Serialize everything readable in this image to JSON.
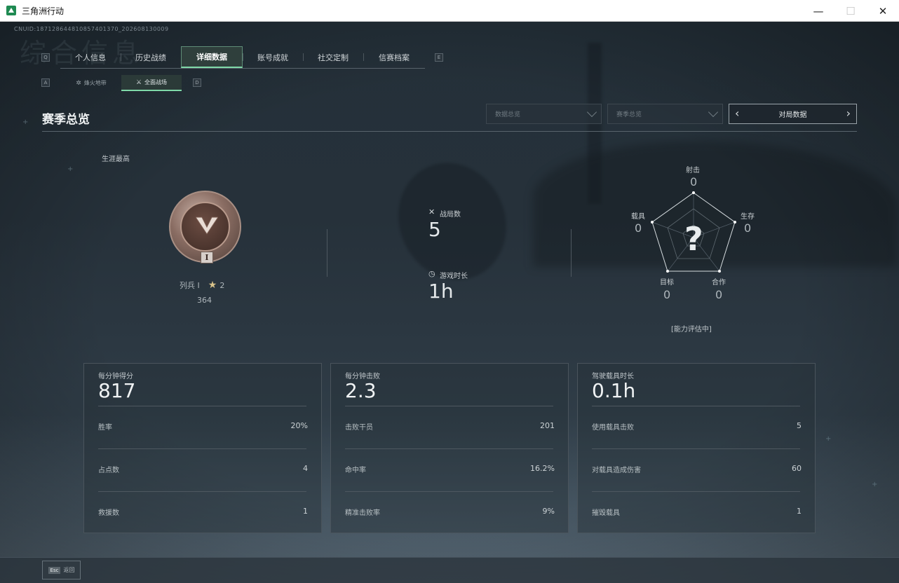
{
  "window": {
    "title": "三角洲行动",
    "minimize": "—",
    "maximize": "☐",
    "close": "✕"
  },
  "header": {
    "uid": "CNUID:187128644810857401370_202608130009",
    "ghost_title": "综合信息"
  },
  "hint_keys": {
    "left_main": "Q",
    "right_main": "E",
    "left_sub": "A",
    "right_sub": "D"
  },
  "main_tabs": [
    {
      "label": "个人信息"
    },
    {
      "label": "历史战绩"
    },
    {
      "label": "详细数据",
      "active": true
    },
    {
      "label": "账号成就"
    },
    {
      "label": "社交定制"
    },
    {
      "label": "信赛档案"
    }
  ],
  "sub_tabs": [
    {
      "label": "烽火地带",
      "icon": "flame-icon"
    },
    {
      "label": "全面战场",
      "icon": "battlefield-icon",
      "active": true
    }
  ],
  "section": {
    "title": "赛季总览",
    "dropdown_1": "数据总览",
    "dropdown_2": "赛季总览",
    "pager_label": "对局数据"
  },
  "rank": {
    "career_label": "生涯最高",
    "plate": "I",
    "rank_name": "列兵 I",
    "stars": "2",
    "points": "364"
  },
  "stats": {
    "matches_label": "战局数",
    "matches_value": "5",
    "playtime_label": "游戏时长",
    "playtime_value": "1h"
  },
  "radar": {
    "question": "?",
    "status": "[能力评估中]",
    "axes": [
      {
        "key": "shoot",
        "label": "射击",
        "value": "0"
      },
      {
        "key": "survive",
        "label": "生存",
        "value": "0"
      },
      {
        "key": "coop",
        "label": "合作",
        "value": "0"
      },
      {
        "key": "objective",
        "label": "目标",
        "value": "0"
      },
      {
        "key": "vehicle",
        "label": "载具",
        "value": "0"
      }
    ]
  },
  "cards": [
    {
      "head": "每分钟得分",
      "big": "817",
      "rows": [
        {
          "label": "胜率",
          "value": "20%"
        },
        {
          "label": "占点数",
          "value": "4"
        },
        {
          "label": "救援数",
          "value": "1"
        }
      ]
    },
    {
      "head": "每分钟击败",
      "big": "2.3",
      "rows": [
        {
          "label": "击败干员",
          "value": "201"
        },
        {
          "label": "命中率",
          "value": "16.2%"
        },
        {
          "label": "精准击败率",
          "value": "9%"
        }
      ]
    },
    {
      "head": "驾驶载具时长",
      "big": "0.1h",
      "rows": [
        {
          "label": "使用载具击败",
          "value": "5"
        },
        {
          "label": "对载具造成伤害",
          "value": "60"
        },
        {
          "label": "摧毁载具",
          "value": "1"
        }
      ]
    }
  ],
  "bottom": {
    "esc_key": "Esc",
    "back_label": "返回"
  }
}
